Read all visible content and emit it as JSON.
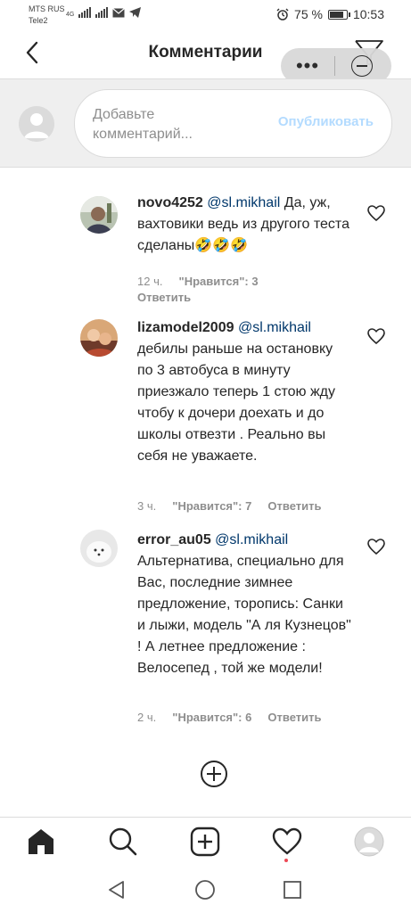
{
  "status_bar": {
    "carrier_1": "MTS RUS",
    "carrier_2": "Tele2",
    "network_type": "4G",
    "battery": "75 %",
    "time": "10:53",
    "icons": [
      "signal-icon",
      "signal-icon",
      "mail-icon",
      "telegram-icon",
      "alarm-icon",
      "battery-icon"
    ]
  },
  "header": {
    "title": "Комментарии",
    "back_icon": "chevron-left-icon",
    "filter_icon": "filter-icon"
  },
  "overlay": {
    "more": "•••",
    "close_icon": "minus-circle-icon"
  },
  "composer": {
    "placeholder": "Добавьте комментарий...",
    "publish_label": "Опубликовать"
  },
  "comments": [
    {
      "username": "novo4252",
      "mention": "@sl.mikhail",
      "text": "Да, уж, вахтовики ведь из другого теста сделаны🤣🤣🤣",
      "time": "12 ч.",
      "likes": "\"Нравится\": 3",
      "reply": "Ответить"
    },
    {
      "username": "lizamodel2009",
      "mention": "@sl.mikhail",
      "text": "дебилы раньше на остановку по 3 автобуса в минуту приезжало теперь 1 стою жду чтобу к дочери доехать и до школы отвезти . Реально вы себя не уважаете.",
      "time": "3 ч.",
      "likes": "\"Нравится\": 7",
      "reply": "Ответить"
    },
    {
      "username": "error_au05",
      "mention": "@sl.mikhail",
      "text": "Альтернатива, специально для Вас, последние зимнее предложение, торопись: Санки и лыжи, модель \"А ля Кузнецов\" ! А летнее предложение : Велосепед , той же модели!",
      "time": "2 ч.",
      "likes": "\"Нравится\": 6",
      "reply": "Ответить"
    }
  ],
  "tab_bar": {
    "icons": [
      "home-icon",
      "search-icon",
      "new-post-icon",
      "activity-heart-icon",
      "profile-avatar"
    ]
  },
  "nav_bar": {
    "icons": [
      "back-triangle-icon",
      "home-circle-icon",
      "recents-square-icon"
    ]
  },
  "colors": {
    "publish_disabled": "#b3dbff",
    "mention": "#00376b",
    "meta": "#8e8e8e",
    "composer_bg": "#efefef",
    "notification_dot": "#ed4956"
  }
}
